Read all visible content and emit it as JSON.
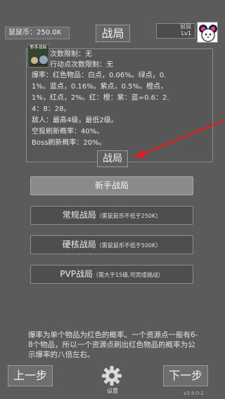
{
  "header": {
    "coins_label": "鼠鼠币：250.0K",
    "title": "战局",
    "user_name": "鼠鼠",
    "user_level": "Lv1"
  },
  "info": {
    "thumb_caption": "新手战局",
    "line1": "次数限制：无",
    "line2": "行动点次数限制：无",
    "lines": [
      "爆率：红色物品：白点，0.06%。绿点，0.",
      "1%。蓝点，0.16%。紫点，0.5%。橙点，",
      "1%，红点，2%。红：橙：紫：蓝=0.6：2.",
      "4：8：28。",
      "敌人：最高4级，最低2级。",
      "空投刷新概率：40%。",
      "Boss刷新概率：20%。"
    ]
  },
  "section_title": "战局",
  "modes": [
    {
      "label": "新手战局",
      "note": ""
    },
    {
      "label": "常规战局",
      "note": "（需鼠鼠币不低于250K）"
    },
    {
      "label": "硬核战局",
      "note": "（需鼠鼠币不低于500K）"
    },
    {
      "label": "PVP战局",
      "note": "（需大于15级,可完成挑战）"
    }
  ],
  "description": "爆率为单个物品为红色的概率。一个资源点一般有6-8个物品，所以一个资源点刷出红色物品的概率为公示爆率的八倍左右。",
  "footer": {
    "prev_label": "上一步",
    "next_label": "下一步",
    "settings_label": "设置",
    "version": "v3.9.0-2"
  },
  "colors": {
    "background": "#5b5b5b",
    "arrow": "#e02020",
    "selected_button": "#8a8a8a"
  },
  "icons": {
    "settings": "gear-icon",
    "avatar": "mouse-avatar-icon",
    "annotation": "red-arrow-icon"
  }
}
